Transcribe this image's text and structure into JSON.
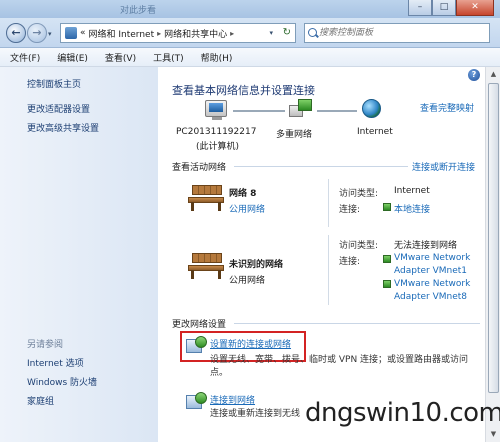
{
  "window": {
    "title": "对此步看",
    "buttons": {
      "minimize": "–",
      "maximize": "□",
      "close": "✕"
    }
  },
  "navbar": {
    "back": "←",
    "forward": "→",
    "dropdown": "▾",
    "address_prefix": "«",
    "address_segments": [
      "网络和 Internet",
      "网络和共享中心"
    ],
    "address_separator": "▸",
    "refresh": "↻",
    "search_placeholder": "搜索控制面板"
  },
  "menu": [
    "文件(F)",
    "编辑(E)",
    "查看(V)",
    "工具(T)",
    "帮助(H)"
  ],
  "left_pane": {
    "links": [
      "控制面板主页",
      "更改适配器设置",
      "更改高级共享设置"
    ],
    "see_also_title": "另请参阅",
    "see_also": [
      "Internet 选项",
      "Windows 防火墙",
      "家庭组"
    ]
  },
  "main": {
    "help": "?",
    "heading": "查看基本网络信息并设置连接",
    "view_full_map": "查看完整映射",
    "map": {
      "computer_name": "PC201311192217",
      "computer_note": "(此计算机)",
      "middle": "多重网络",
      "internet": "Internet"
    },
    "active_title": "查看活动网络",
    "connect_disconnect": "连接或断开连接",
    "networks": [
      {
        "name": "网络  8",
        "type": "公用网络",
        "access_label": "访问类型:",
        "access_value": "Internet",
        "conn_label": "连接:",
        "conn_values": [
          "本地连接"
        ]
      },
      {
        "name": "未识别的网络",
        "type": "公用网络",
        "access_label": "访问类型:",
        "access_value": "无法连接到网络",
        "conn_label": "连接:",
        "conn_values": [
          "VMware Network",
          "Adapter VMnet1",
          "VMware Network",
          "Adapter VMnet8"
        ]
      }
    ],
    "change_title": "更改网络设置",
    "tasks": [
      {
        "link": "设置新的连接或网络",
        "desc_line1": "设置无线、宽带、拨号、临时或 VPN 连接；或设置路由器或访问",
        "desc_line2": "点。"
      },
      {
        "link": "连接到网络",
        "desc_line1": "连接或重新连接到无线"
      }
    ]
  },
  "scrollbar": {
    "up": "▲",
    "down": "▼"
  },
  "watermark": "dngswin10.com"
}
